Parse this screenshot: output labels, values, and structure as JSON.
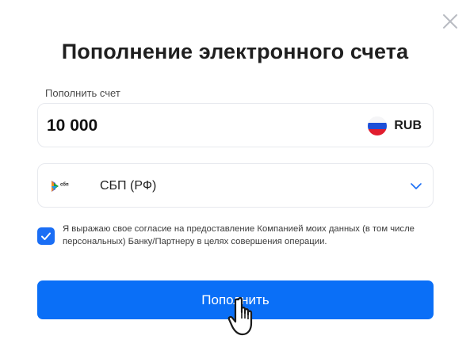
{
  "dialog": {
    "title": "Пополнение электронного счета",
    "close_icon": "close-icon"
  },
  "amount": {
    "label": "Пополнить счет",
    "value": "10 000",
    "currency_code": "RUB",
    "currency_flag_icon": "russia-flag-icon"
  },
  "payment_method": {
    "logo_icon": "sbp-logo-icon",
    "logo_text": "сбп",
    "selected_label": "СБП (РФ)",
    "dropdown_icon": "chevron-down-icon"
  },
  "consent": {
    "checked": true,
    "text": "Я выражаю свое согласие на предоставление Компанией моих данных (в том числе персональных) Банку/Партнеру в целях совершения операции."
  },
  "submit": {
    "label": "Пополнить"
  },
  "colors": {
    "accent": "#0a6ff7",
    "checkbox": "#1a6ef5",
    "border": "#e7e9ee",
    "chevron": "#1a6ef5"
  }
}
